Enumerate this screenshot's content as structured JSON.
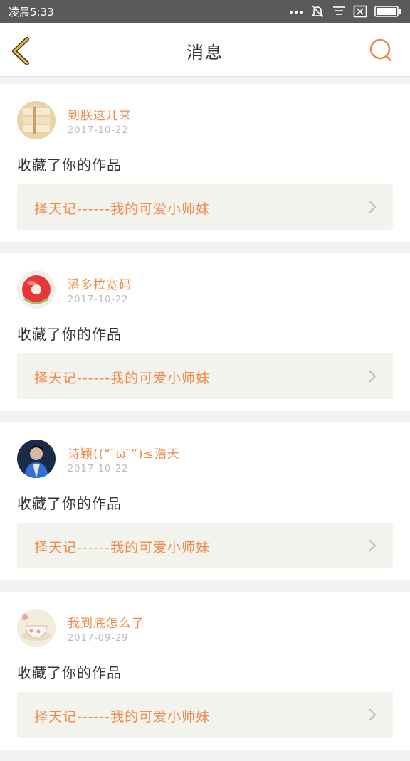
{
  "status_bar": {
    "time": "凌晨5:33",
    "icons": [
      "more-dots-icon",
      "bell-muted-icon",
      "notification-list-icon",
      "sim-x-icon",
      "battery-icon"
    ]
  },
  "header": {
    "title": "消息",
    "back_icon": "chevron-left-icon",
    "search_icon": "search-icon"
  },
  "colors": {
    "accent": "#f08a4b",
    "back_icon": "#e8b92a",
    "status_bar": "#5a5a5a",
    "work_card_bg": "#f3f3ed"
  },
  "messages": [
    {
      "user": "到朕这儿来",
      "date": "2017-10-22",
      "action": "收藏了你的作品",
      "work_title": "择天记------我的可爱小师妹",
      "avatar": "book-stack-avatar"
    },
    {
      "user": "潘多拉宽码",
      "date": "2017-10-22",
      "action": "收藏了你的作品",
      "work_title": "择天记------我的可爱小师妹",
      "avatar": "red-donut-avatar"
    },
    {
      "user": "诗颖((“ ̄ω ̄”)≤浩天",
      "date": "2017-10-22",
      "action": "收藏了你的作品",
      "work_title": "择天记------我的可爱小师妹",
      "avatar": "person-dark-avatar"
    },
    {
      "user": "我到底怎么了",
      "date": "2017-09-29",
      "action": "收藏了你的作品",
      "work_title": "择天记------我的可爱小师妹",
      "avatar": "teacup-avatar"
    }
  ]
}
